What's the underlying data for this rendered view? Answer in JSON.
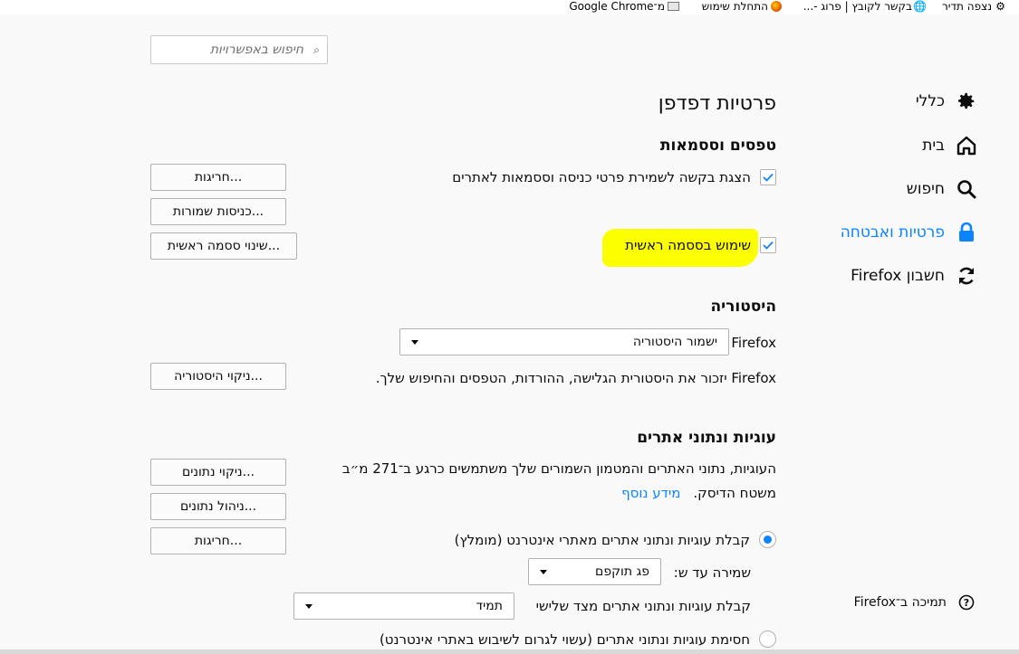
{
  "bookmarks": {
    "items": [
      {
        "label": "נצפה תדיר",
        "icon": "gear-icon"
      },
      {
        "label": "בקשר לקובץ | פרוג -...",
        "icon": "globe-icon"
      },
      {
        "label": "התחלת שימוש",
        "icon": "firefox-icon"
      },
      {
        "label": "מ־Google Chrome",
        "icon": "folder-icon"
      }
    ]
  },
  "search": {
    "placeholder": "חיפוש באפשרויות"
  },
  "sidebar": {
    "items": [
      {
        "label": "כללי",
        "icon": "gear-icon"
      },
      {
        "label": "בית",
        "icon": "home-icon"
      },
      {
        "label": "חיפוש",
        "icon": "search-icon"
      },
      {
        "label": "פרטיות ואבטחה",
        "icon": "lock-icon",
        "selected": true
      },
      {
        "label": "חשבון Firefox",
        "icon": "sync-icon"
      }
    ],
    "support": {
      "label": "תמיכה ב־Firefox",
      "icon": "help-icon"
    }
  },
  "main": {
    "title": "פרטיות דפדפן",
    "forms": {
      "heading": "טפסים וססמאות",
      "ask_save_label": "הצגת בקשה לשמירת פרטי כניסה וססמאות לאתרים",
      "ask_save_checked": true,
      "master_password_label": "שימוש בססמה ראשית",
      "master_password_checked": true,
      "exceptions_button": "חריגות...",
      "saved_logins_button": "כניסות שמורות...",
      "change_master_button": "שינוי ססמה ראשית..."
    },
    "history": {
      "heading": "היסטוריה",
      "firefox_will_label": "Firefox",
      "mode_value": "ישמור היסטוריה",
      "description": "Firefox יזכור את היסטורית הגלישה, ההורדות, הטפסים והחיפוש שלך.",
      "clear_button": "ניקוי היסטוריה..."
    },
    "cookies": {
      "heading": "עוגיות ונתוני אתרים",
      "description_line1": "העוגיות, נתוני האתרים והמטמון השמורים שלך משתמשים כרגע ב־271 מ״ב",
      "description_line2": "משטח הדיסק.",
      "learn_more": "מידע נוסף",
      "clear_data_button": "ניקוי נתונים...",
      "manage_data_button": "ניהול נתונים...",
      "exceptions_button": "חריגות...",
      "accept_label": "קבלת עוגיות ונתוני אתרים מאתרי אינטרנט (מומלץ)",
      "keep_until_label": "שמירה עד ש:",
      "keep_until_value": "פג תוקפם",
      "third_party_label": "קבלת עוגיות ונתוני אתרים מצד שלישי",
      "third_party_value": "תמיד",
      "block_label": "חסימת עוגיות ונתוני אתרים (עשוי לגרום לשיבוש באתרי אינטרנט)"
    }
  },
  "colors": {
    "accent": "#0a84ff",
    "highlight": "#fbff00",
    "background": "#f9f9fa"
  }
}
